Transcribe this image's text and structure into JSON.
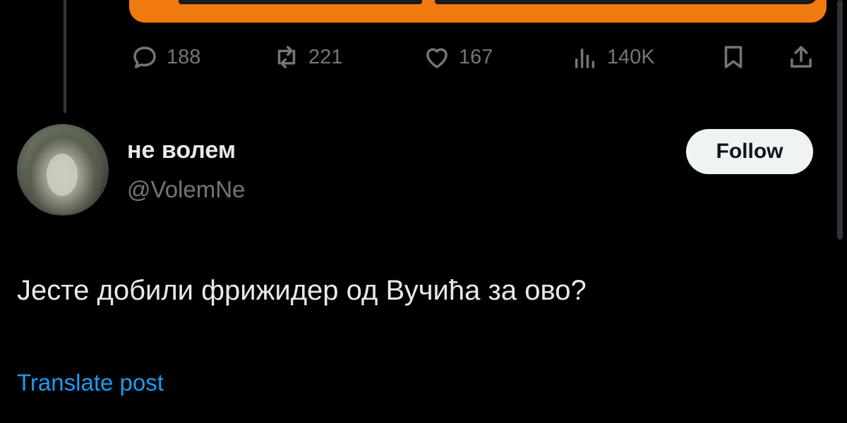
{
  "stats": {
    "replies": "188",
    "reposts": "221",
    "likes": "167",
    "views": "140K"
  },
  "icons": {
    "reply": "reply-icon",
    "repost": "repost-icon",
    "like": "heart-icon",
    "views": "views-icon",
    "bookmark": "bookmark-icon",
    "share": "share-icon"
  },
  "post": {
    "display_name": "не волем",
    "handle": "@VolemNe",
    "follow_label": "Follow",
    "text": "Јесте добили фрижидер од Вучића за ово?",
    "translate_label": "Translate post"
  },
  "colors": {
    "background": "#000000",
    "accent": "#1d9bf0",
    "muted": "#71767b",
    "media_card": "#f07a10"
  }
}
